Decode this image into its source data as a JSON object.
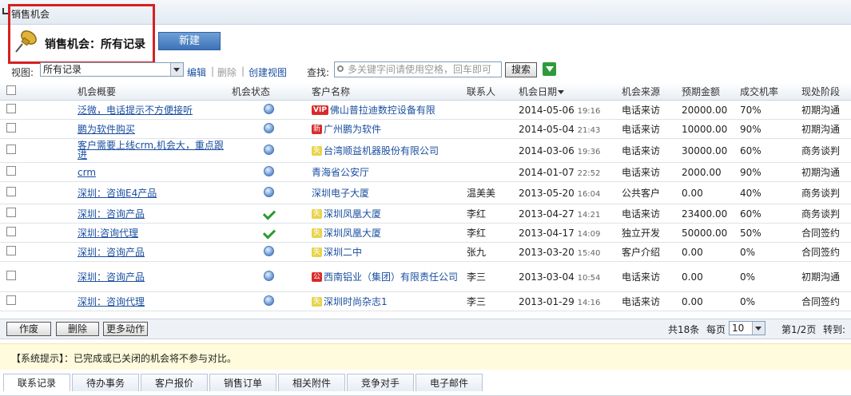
{
  "breadcrumb": "销售机会",
  "page_title": "销售机会：所有记录",
  "new_button": "新建",
  "toolbar": {
    "view_label": "视图:",
    "view_value": "所有记录",
    "edit": "编辑",
    "delete": "删除",
    "create_view": "创建视图",
    "search_label": "查找:",
    "search_placeholder": "多关键字间请使用空格，回车即可",
    "search_button": "搜索"
  },
  "columns": [
    "机会概要",
    "机会状态",
    "客户名称",
    "联系人",
    "机会日期",
    "机会来源",
    "预期金额",
    "成交机率",
    "现处阶段"
  ],
  "rows": [
    {
      "summary": "泛微，电话提示不方便接听",
      "status": "dot",
      "badge": "VIP",
      "badge_type": "vip",
      "customer": "佛山普拉迪数控设备有限",
      "contact": "",
      "date": "2014-05-06",
      "time": "19:16",
      "source": "电话来访",
      "amount": "20000.00",
      "prob": "70%",
      "stage": "初期沟通"
    },
    {
      "summary": "鹏为软件购买",
      "status": "dot",
      "badge": "新",
      "badge_type": "new",
      "customer": "广州鹏为软件",
      "contact": "",
      "date": "2014-05-04",
      "time": "21:43",
      "source": "电话来访",
      "amount": "10000.00",
      "prob": "90%",
      "stage": "初期沟通"
    },
    {
      "summary": "客户需要上线crm,机会大，重点跟进",
      "status": "dot",
      "badge": "失",
      "badge_type": "lost",
      "customer": "台湾顺益机器股份有限公司",
      "contact": "",
      "date": "2014-03-06",
      "time": "19:36",
      "source": "电话来访",
      "amount": "30000.00",
      "prob": "60%",
      "stage": "商务谈判"
    },
    {
      "summary": "crm",
      "status": "dot",
      "badge": "",
      "badge_type": "",
      "customer": "青海省公安厅",
      "contact": "",
      "date": "2014-01-07",
      "time": "22:52",
      "source": "电话来访",
      "amount": "2000.00",
      "prob": "90%",
      "stage": "初期沟通"
    },
    {
      "summary": "深圳：咨询E4产品",
      "status": "dot",
      "badge": "",
      "badge_type": "",
      "customer": "深圳电子大厦",
      "contact": "温美美",
      "date": "2013-05-20",
      "time": "16:04",
      "source": "公共客户",
      "amount": "0.00",
      "prob": "40%",
      "stage": "商务谈判"
    },
    {
      "summary": "深圳：咨询产品",
      "status": "check",
      "badge": "失",
      "badge_type": "lost",
      "customer": "深圳凤凰大厦",
      "contact": "李红",
      "date": "2013-04-27",
      "time": "14:21",
      "source": "电话来访",
      "amount": "23400.00",
      "prob": "60%",
      "stage": "商务谈判"
    },
    {
      "summary": "深圳:咨询代理",
      "status": "check",
      "badge": "失",
      "badge_type": "lost",
      "customer": "深圳凤凰大厦",
      "contact": "李红",
      "date": "2013-04-17",
      "time": "14:09",
      "source": "独立开发",
      "amount": "50000.00",
      "prob": "50%",
      "stage": "合同签约"
    },
    {
      "summary": "深圳：咨询产品",
      "status": "dot",
      "badge": "失",
      "badge_type": "lost",
      "customer": "深圳二中",
      "contact": "张九",
      "date": "2013-03-20",
      "time": "15:40",
      "source": "客户介绍",
      "amount": "0.00",
      "prob": "0%",
      "stage": "合同签约"
    },
    {
      "summary": "深圳：咨询产品",
      "status": "dot",
      "badge": "公",
      "badge_type": "pub",
      "customer": "西南铝业（集团）有限责任公司",
      "contact": "李三",
      "date": "2013-03-04",
      "time": "10:54",
      "source": "电话来访",
      "amount": "0.00",
      "prob": "0%",
      "stage": "初期沟通"
    },
    {
      "summary": "深圳：咨询代理",
      "status": "dot",
      "badge": "失",
      "badge_type": "lost",
      "customer": "深圳时尚杂志1",
      "contact": "李三",
      "date": "2013-01-29",
      "time": "14:16",
      "source": "电话来访",
      "amount": "0.00",
      "prob": "0%",
      "stage": "合同签约"
    }
  ],
  "footer": {
    "void_button": "作废",
    "delete_button": "删除",
    "more_button": "更多动作",
    "total": "共18条",
    "per_page_label": "每页",
    "per_page_value": "10",
    "page_info": "第1/2页",
    "goto_label": "转到:"
  },
  "notice": "【系统提示】：已完成或已关闭的机会将不参与对比。",
  "tabs": [
    "联系记录",
    "待办事务",
    "客户报价",
    "销售订单",
    "相关附件",
    "竞争对手",
    "电子邮件"
  ]
}
